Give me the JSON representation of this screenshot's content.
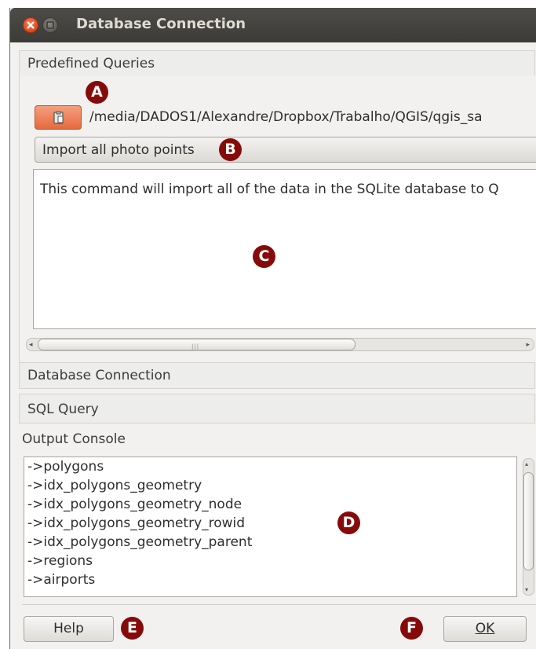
{
  "window": {
    "title": "Database Connection"
  },
  "sections": {
    "predefined": "Predefined Queries",
    "database_connection": "Database Connection",
    "sql_query": "SQL Query"
  },
  "predefined": {
    "path": "/media/DADOS1/Alexandre/Dropbox/Trabalho/QGIS/qgis_sa",
    "query": "Import all photo points",
    "description": "This command will import all of the data in the SQLite database to Q"
  },
  "output": {
    "label": "Output Console",
    "lines": [
      "->polygons",
      "->idx_polygons_geometry",
      "->idx_polygons_geometry_node",
      "->idx_polygons_geometry_rowid",
      "->idx_polygons_geometry_parent",
      "->regions",
      "->airports"
    ]
  },
  "buttons": {
    "help": "Help",
    "ok": "OK"
  },
  "markers": [
    "A",
    "B",
    "C",
    "D",
    "E",
    "F"
  ],
  "colors": {
    "marker": "#850b0b",
    "accent_button": "#e6693e",
    "titlebar": "#3c3b37"
  },
  "icons": {
    "path_button": "paste-icon",
    "close": "close-icon",
    "minimize": "minimize-icon"
  }
}
